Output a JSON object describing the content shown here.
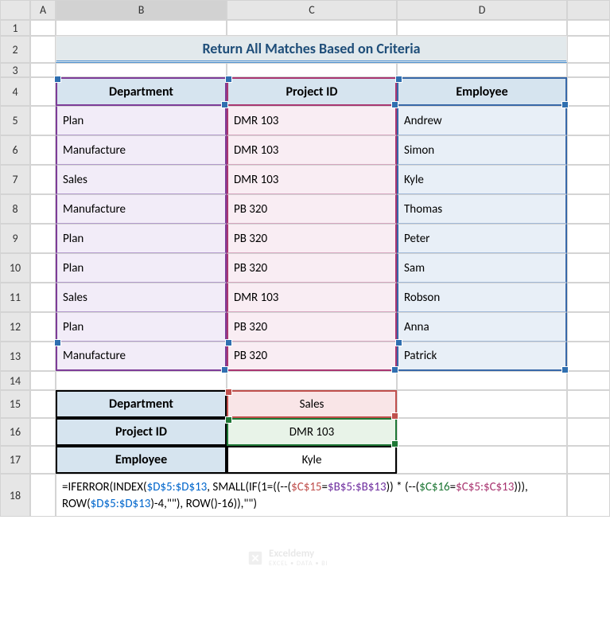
{
  "columns": [
    "",
    "A",
    "B",
    "C",
    "D",
    ""
  ],
  "rows": [
    "1",
    "2",
    "3",
    "4",
    "5",
    "6",
    "7",
    "8",
    "9",
    "10",
    "11",
    "12",
    "13",
    "14",
    "15",
    "16",
    "17",
    "18"
  ],
  "title": "Return All Matches Based on Criteria",
  "headers": {
    "dept": "Department",
    "proj": "Project ID",
    "emp": "Employee"
  },
  "data": [
    {
      "dept": "Plan",
      "proj": "DMR 103",
      "emp": "Andrew"
    },
    {
      "dept": "Manufacture",
      "proj": "DMR 103",
      "emp": "Simon"
    },
    {
      "dept": "Sales",
      "proj": "DMR 103",
      "emp": "Kyle"
    },
    {
      "dept": "Manufacture",
      "proj": "PB 320",
      "emp": "Thomas"
    },
    {
      "dept": "Plan",
      "proj": "PB 320",
      "emp": "Peter"
    },
    {
      "dept": "Plan",
      "proj": "PB 320",
      "emp": "Sam"
    },
    {
      "dept": "Sales",
      "proj": "DMR 103",
      "emp": "Robson"
    },
    {
      "dept": "Plan",
      "proj": "PB 320",
      "emp": "Anna"
    },
    {
      "dept": "Manufacture",
      "proj": "PB 320",
      "emp": "Patrick"
    }
  ],
  "criteria": {
    "dept_label": "Department",
    "dept_val": "Sales",
    "proj_label": "Project ID",
    "proj_val": "DMR 103",
    "emp_label": "Employee",
    "emp_val": "Kyle"
  },
  "formula": {
    "p1": "=IFERROR(INDEX(",
    "r1": "$D$5:$D$13",
    "p2": ", SMALL(IF(1=((--(",
    "r2": "$C$15",
    "p3": "=",
    "r3": "$B$5:$B$13",
    "p4": ")) * (--(",
    "r4": "$C$16",
    "p5": "=",
    "r5": "$C$5:$C$13",
    "p6": "))), ROW(",
    "r6": "$D$5:$D$13",
    "p7": ")-4,\"\"), ROW()-16)),\"\")"
  },
  "watermark": {
    "brand": "Exceldemy",
    "tagline": "EXCEL • DATA • BI"
  }
}
